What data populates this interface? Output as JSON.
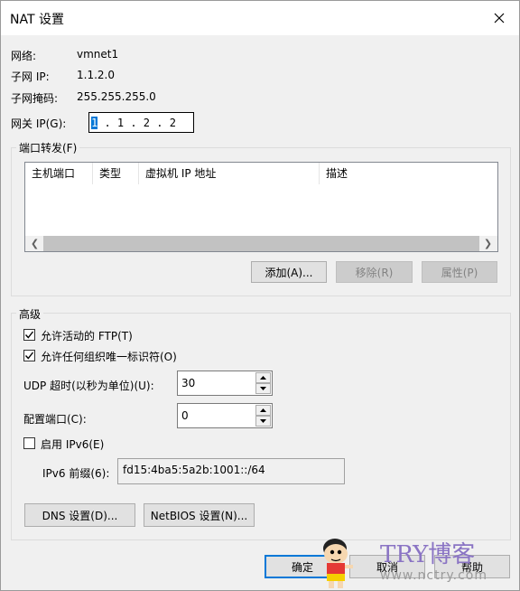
{
  "window": {
    "title": "NAT 设置"
  },
  "info": {
    "network_label": "网络:",
    "network_value": "vmnet1",
    "subnet_ip_label": "子网 IP:",
    "subnet_ip_value": "1.1.2.0",
    "subnet_mask_label": "子网掩码:",
    "subnet_mask_value": "255.255.255.0",
    "gateway_label": "网关 IP(G):",
    "gateway_first_octet": "1",
    "gateway_rest": " . 1 . 2 . 2"
  },
  "port_forwarding": {
    "legend": "端口转发(F)",
    "columns": [
      "主机端口",
      "类型",
      "虚拟机 IP 地址",
      "描述"
    ],
    "add_label": "添加(A)...",
    "remove_label": "移除(R)",
    "properties_label": "属性(P)"
  },
  "advanced": {
    "legend": "高级",
    "allow_ftp_label": "允许活动的 FTP(T)",
    "allow_ftp_checked": true,
    "allow_org_id_label": "允许任何组织唯一标识符(O)",
    "allow_org_id_checked": true,
    "udp_timeout_label": "UDP 超时(以秒为单位)(U):",
    "udp_timeout_value": "30",
    "config_port_label": "配置端口(C):",
    "config_port_value": "0",
    "enable_ipv6_label": "启用 IPv6(E)",
    "enable_ipv6_checked": false,
    "ipv6_prefix_label": "IPv6 前缀(6):",
    "ipv6_prefix_value": "fd15:4ba5:5a2b:1001::/64",
    "dns_label": "DNS 设置(D)...",
    "netbios_label": "NetBIOS 设置(N)..."
  },
  "footer": {
    "ok_label": "确定",
    "cancel_label": "取消",
    "help_label": "帮助"
  },
  "watermark": {
    "text": "TRY博客",
    "url": "www.nctry.com"
  },
  "colors": {
    "accent": "#0078d7",
    "dialog_bg": "#f0f0f0",
    "watermark": "#8a74c4"
  }
}
